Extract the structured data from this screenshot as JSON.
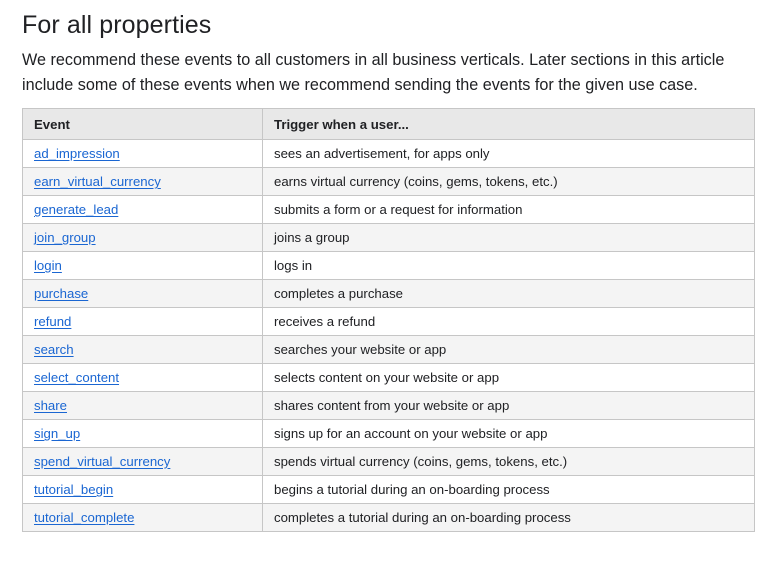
{
  "section": {
    "title": "For all properties",
    "intro": "We recommend these events to all customers in all business verticals. Later sections in this article include some of these events when we recommend sending the events for the given use case."
  },
  "table": {
    "headers": [
      "Event",
      "Trigger when a user..."
    ],
    "rows": [
      {
        "event": "ad_impression",
        "trigger": "sees an advertisement, for apps only"
      },
      {
        "event": "earn_virtual_currency",
        "trigger": "earns virtual currency (coins, gems, tokens, etc.)"
      },
      {
        "event": "generate_lead",
        "trigger": "submits a form or a request for information"
      },
      {
        "event": "join_group",
        "trigger": "joins a group"
      },
      {
        "event": "login",
        "trigger": "logs in"
      },
      {
        "event": "purchase",
        "trigger": "completes a purchase"
      },
      {
        "event": "refund",
        "trigger": "receives a refund"
      },
      {
        "event": "search",
        "trigger": "searches your website or app"
      },
      {
        "event": "select_content",
        "trigger": "selects content on your website or app"
      },
      {
        "event": "share",
        "trigger": "shares content from your website or app"
      },
      {
        "event": "sign_up",
        "trigger": "signs up for an account on your website or app"
      },
      {
        "event": "spend_virtual_currency",
        "trigger": "spends virtual currency (coins, gems, tokens, etc.)"
      },
      {
        "event": "tutorial_begin",
        "trigger": "begins a tutorial during an on-boarding process"
      },
      {
        "event": "tutorial_complete",
        "trigger": "completes a tutorial during an on-boarding process"
      }
    ]
  },
  "colors": {
    "link": "#1a66d2",
    "header_bg": "#e8e8e8",
    "stripe_bg": "#f4f4f4",
    "border": "#c6c6c6"
  }
}
